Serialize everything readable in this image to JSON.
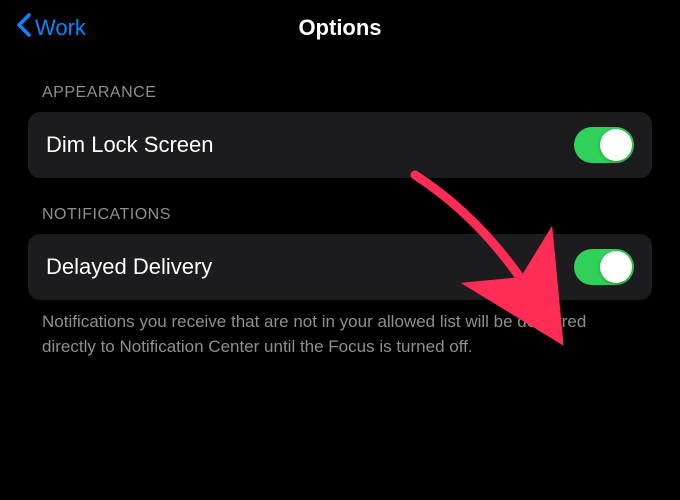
{
  "nav": {
    "back_label": "Work",
    "title": "Options"
  },
  "sections": {
    "appearance": {
      "header": "APPEARANCE",
      "dim_lock_screen_label": "Dim Lock Screen",
      "dim_lock_screen_on": true
    },
    "notifications": {
      "header": "NOTIFICATIONS",
      "delayed_delivery_label": "Delayed Delivery",
      "delayed_delivery_on": true,
      "footer": "Notifications you receive that are not in your allowed list will be delivered directly to Notification Center until the Focus is turned off."
    }
  },
  "colors": {
    "accent": "#0a84ff",
    "toggle_on": "#30d158",
    "row_bg": "#1c1c1e",
    "secondary_text": "#8e8e93"
  }
}
